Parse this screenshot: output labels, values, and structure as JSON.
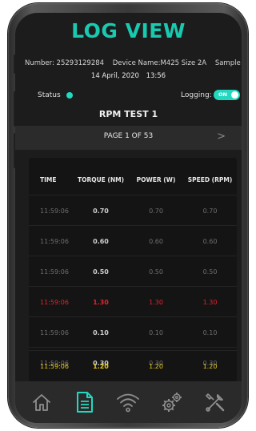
{
  "header": {
    "title": "LOG VIEW",
    "number": "Number: 25293129284",
    "device_name": "Device Name:M425 Size 2A",
    "sample": "Sample",
    "date": "14 April, 2020",
    "time": "13:56"
  },
  "status": {
    "label": "Status",
    "color": "#22d8bf"
  },
  "logging": {
    "label": "Logging:",
    "toggle_text": "ON",
    "state": "on",
    "color": "#22d8bf"
  },
  "test": {
    "name": "RPM TEST 1"
  },
  "pager": {
    "label": "PAGE 1 OF 53",
    "next": ">"
  },
  "table": {
    "headers": [
      "TIME",
      "TORQUE (NM)",
      "POWER (W)",
      "SPEED (RPM)"
    ],
    "rows": [
      {
        "time": "11:59:06",
        "torque": "0.70",
        "power": "0.70",
        "speed": "0.70",
        "status": "normal"
      },
      {
        "time": "11:59:06",
        "torque": "0.60",
        "power": "0.60",
        "speed": "0.60",
        "status": "normal"
      },
      {
        "time": "11:59:06",
        "torque": "0.50",
        "power": "0.50",
        "speed": "0.50",
        "status": "normal"
      },
      {
        "time": "11:59:06",
        "torque": "1.30",
        "power": "1.30",
        "speed": "1.30",
        "status": "error"
      },
      {
        "time": "11:59:06",
        "torque": "0.10",
        "power": "0.10",
        "speed": "0.10",
        "status": "normal"
      },
      {
        "time": "11:59:06",
        "torque": "0.30",
        "power": "0.30",
        "speed": "0.30",
        "status": "normal"
      },
      {
        "time": "11:59:06",
        "torque": "1.20",
        "power": "1.20",
        "speed": "1.20",
        "status": "warning"
      }
    ]
  },
  "colors": {
    "accent": "#19c9b0",
    "error": "#e0242e",
    "warning": "#e6c617"
  },
  "nav": [
    {
      "icon": "home-icon",
      "active": false
    },
    {
      "icon": "document-icon",
      "active": true
    },
    {
      "icon": "wifi-icon",
      "active": false
    },
    {
      "icon": "gears-icon",
      "active": false
    },
    {
      "icon": "tools-icon",
      "active": false
    }
  ]
}
